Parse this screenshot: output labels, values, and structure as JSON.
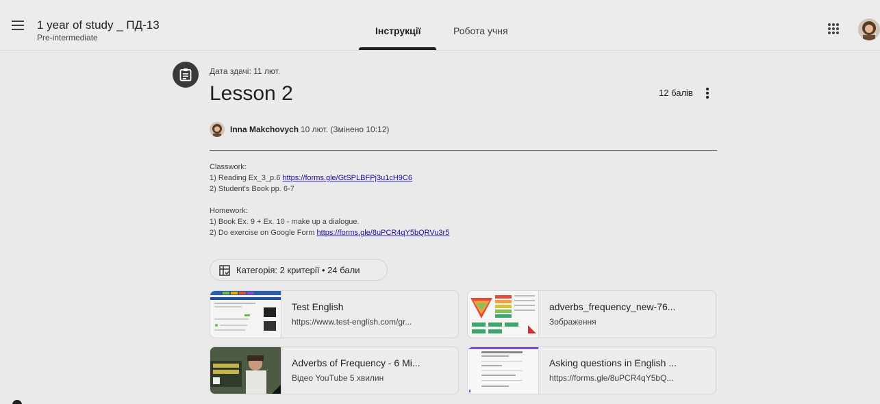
{
  "header": {
    "class_title": "1 year of study _ ПД-13",
    "class_subtitle": "Pre-intermediate",
    "tabs": [
      {
        "label": "Інструкції",
        "active": true
      },
      {
        "label": "Робота учня",
        "active": false
      }
    ]
  },
  "assignment": {
    "due": "Дата здачі: 11 лют.",
    "title": "Lesson 2",
    "points": "12 балів",
    "author": "Inna Makchovych",
    "posted": "10 лют. (Змінено 10:12)",
    "description": {
      "classwork_heading": "Classwork:",
      "item1_text": "1) Reading Ex_3_p.6 ",
      "item1_link": "https://forms.gle/GtSPLBFPj3u1cH9C6",
      "item2_text": "2) Student's Book pp. 6-7",
      "homework_heading": "Homework:",
      "hw1_text": "1) Book Ex. 9 + Ex. 10 - make up a dialogue.",
      "hw2_text": "2) Do exercise on Google Form ",
      "hw2_link": "https://forms.gle/8uPCR4qY5bQRVu3r5"
    },
    "rubric": "Категорія: 2 критерії • 24 бали"
  },
  "attachments": [
    {
      "title": "Test English",
      "subtitle": "https://www.test-english.com/gr..."
    },
    {
      "title": "adverbs_frequency_new-76...",
      "subtitle": "Зображення"
    },
    {
      "title": "Adverbs of Frequency - 6 Mi...",
      "subtitle": "Відео YouTube  5 хвилин"
    },
    {
      "title": "Asking questions in English ...",
      "subtitle": "https://forms.gle/8uPCR4qY5bQ..."
    }
  ],
  "colors": {
    "background": "#eaeaea",
    "assignment_icon_bg": "#3a3a3a",
    "link": "#1a0dab"
  }
}
